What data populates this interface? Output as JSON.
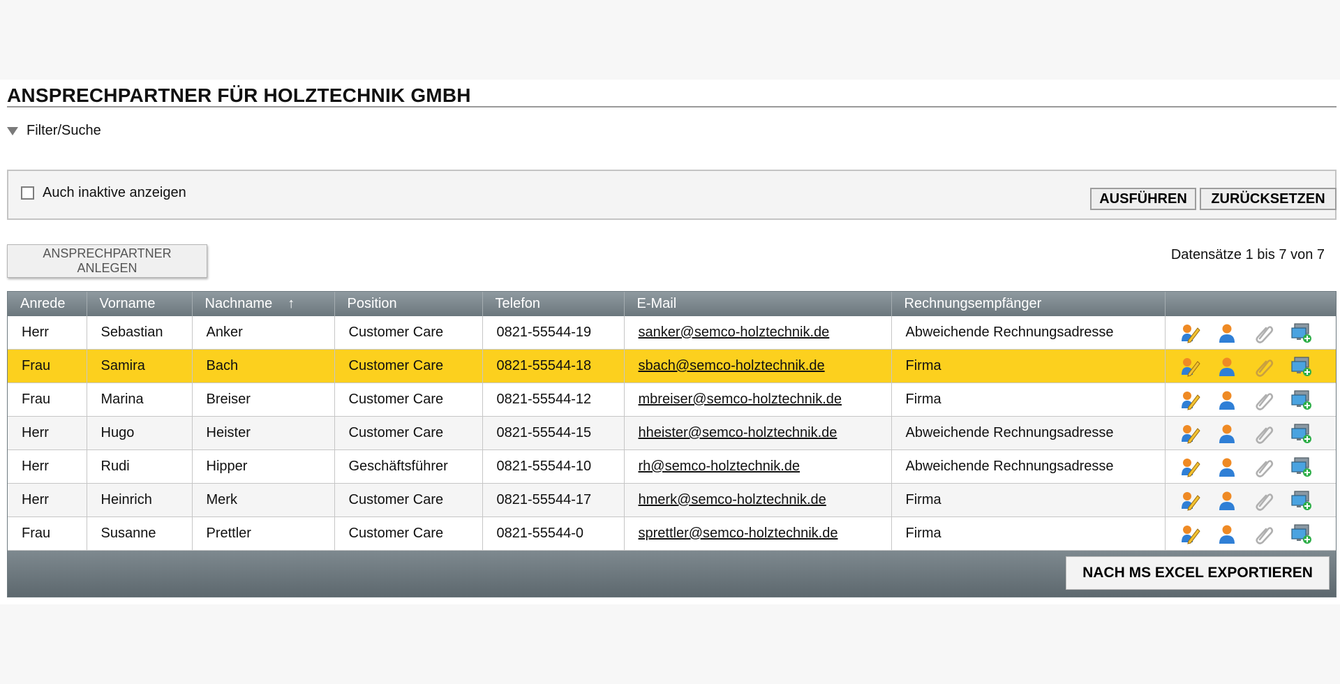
{
  "page": {
    "title": "ANSPRECHPARTNER FÜR HOLZTECHNIK GMBH",
    "filter_toggle_label": "Filter/Suche",
    "show_inactive_label": "Auch inaktive anzeigen",
    "show_inactive_checked": false,
    "run_button": "AUSFÜHREN",
    "reset_button": "ZURÜCKSETZEN",
    "create_button": "ANSPRECHPARTNER ANLEGEN",
    "record_info": "Datensätze 1 bis 7 von 7",
    "export_button": "NACH MS EXCEL EXPORTIEREN"
  },
  "table": {
    "sort_column": "Nachname",
    "sort_direction": "ascending",
    "columns": [
      "Anrede",
      "Vorname",
      "Nachname",
      "Position",
      "Telefon",
      "E-Mail",
      "Rechnungsempfänger",
      ""
    ],
    "rows": [
      {
        "anrede": "Herr",
        "vorname": "Sebastian",
        "nachname": "Anker",
        "position": "Customer Care",
        "telefon": "0821-55544-19",
        "email": "sanker@semco-holztechnik.de",
        "rechnung": "Abweichende Rechnungsadresse",
        "selected": false
      },
      {
        "anrede": "Frau",
        "vorname": "Samira",
        "nachname": "Bach",
        "position": "Customer Care",
        "telefon": "0821-55544-18",
        "email": "sbach@semco-holztechnik.de",
        "rechnung": "Firma",
        "selected": true
      },
      {
        "anrede": "Frau",
        "vorname": "Marina",
        "nachname": "Breiser",
        "position": "Customer Care",
        "telefon": "0821-55544-12",
        "email": "mbreiser@semco-holztechnik.de",
        "rechnung": "Firma",
        "selected": false
      },
      {
        "anrede": "Herr",
        "vorname": "Hugo",
        "nachname": "Heister",
        "position": "Customer Care",
        "telefon": "0821-55544-15",
        "email": "hheister@semco-holztechnik.de",
        "rechnung": "Abweichende Rechnungsadresse",
        "selected": false
      },
      {
        "anrede": "Herr",
        "vorname": "Rudi",
        "nachname": "Hipper",
        "position": "Geschäftsführer",
        "telefon": "0821-55544-10",
        "email": "rh@semco-holztechnik.de",
        "rechnung": "Abweichende Rechnungsadresse",
        "selected": false
      },
      {
        "anrede": "Herr",
        "vorname": "Heinrich",
        "nachname": "Merk",
        "position": "Customer Care",
        "telefon": "0821-55544-17",
        "email": "hmerk@semco-holztechnik.de",
        "rechnung": "Firma",
        "selected": false
      },
      {
        "anrede": "Frau",
        "vorname": "Susanne",
        "nachname": "Prettler",
        "position": "Customer Care",
        "telefon": "0821-55544-0",
        "email": "sprettler@semco-holztechnik.de",
        "rechnung": "Firma",
        "selected": false
      }
    ],
    "row_actions": [
      "edit-icon",
      "person-icon",
      "paperclip-icon",
      "monitor-add-icon"
    ]
  },
  "colors": {
    "selected_row": "#fcd01e",
    "header_bg": "#6b777d",
    "footer_bg": "#5d686e"
  }
}
